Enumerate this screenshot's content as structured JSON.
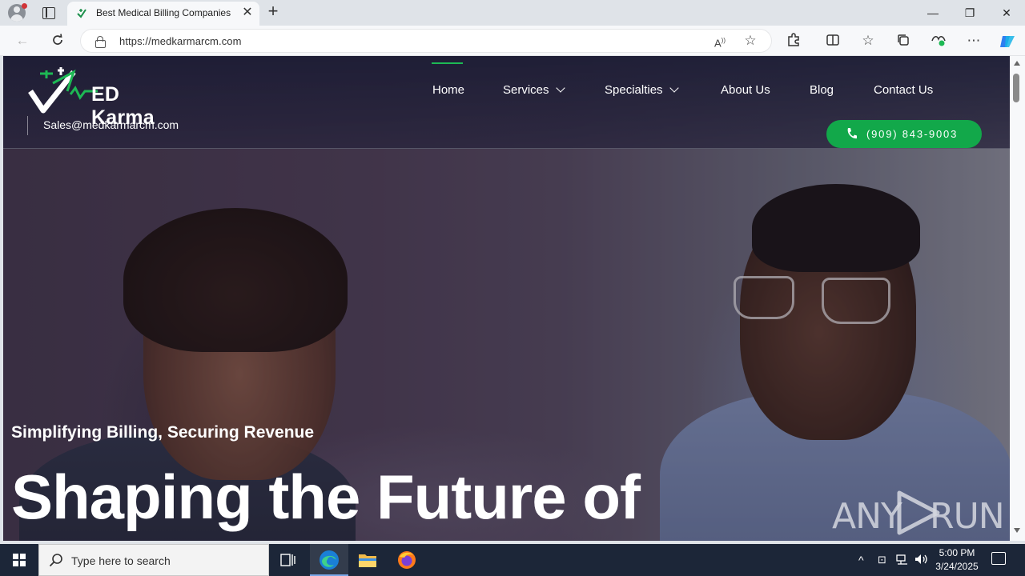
{
  "browser": {
    "tab_title": "Best Medical Billing Companies i",
    "tab_close": "✕",
    "new_tab": "+",
    "url": "https://medkarmarcm.com",
    "window": {
      "minimize": "—",
      "restore": "❐",
      "close": "✕"
    }
  },
  "site": {
    "logo_text": "ED Karma",
    "email": "Sales@medkarmarcm.com",
    "nav": {
      "home": "Home",
      "services": "Services",
      "specialties": "Specialties",
      "about": "About Us",
      "blog": "Blog",
      "contact": "Contact Us"
    },
    "phone": "(909) 843-9003",
    "tagline": "Simplifying Billing, Securing Revenue",
    "headline": "Shaping the Future of",
    "colors": {
      "accent": "#12a84a",
      "nav_active": "#1db954"
    }
  },
  "watermark": {
    "left": "ANY",
    "right": "RUN"
  },
  "taskbar": {
    "search_placeholder": "Type here to search",
    "time": "5:00 PM",
    "date": "3/24/2025"
  }
}
